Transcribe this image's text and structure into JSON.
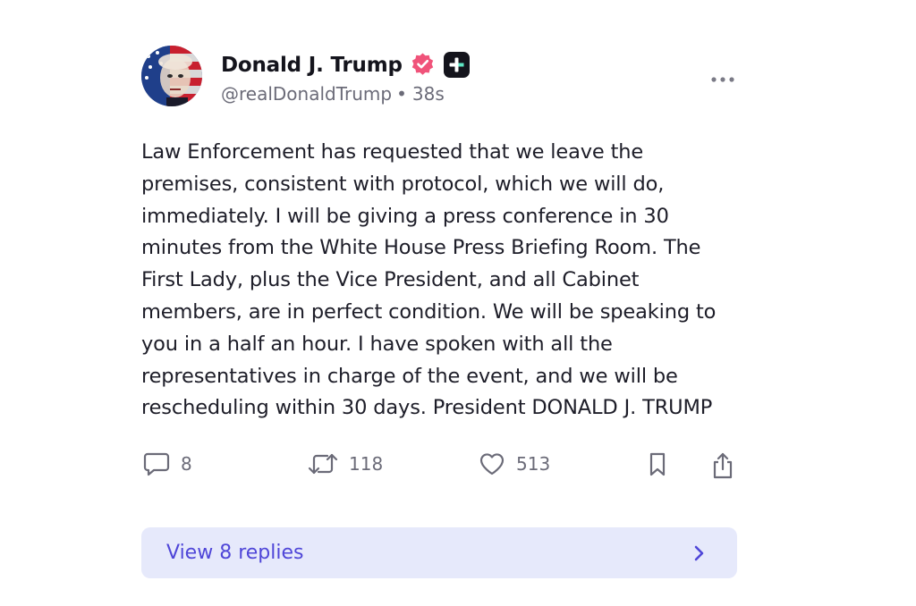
{
  "post": {
    "author": {
      "display_name": "Donald J. Trump",
      "handle": "@realDonaldTrump",
      "separator": "•",
      "time_ago": "38s"
    },
    "badges": [
      "verified-icon",
      "plus-badge-icon"
    ],
    "body": "Law Enforcement has requested that we leave the premises, consistent with protocol, which we will do, immediately. I will be giving a press conference in 30 minutes from the White House Press Briefing Room. The First Lady, plus the Vice President, and all Cabinet members, are in perfect condition. We will be speaking to you in a half an hour. I have spoken with all the representatives in charge of the event, and we will be rescheduling within 30 days. President DONALD J. TRUMP",
    "actions": {
      "replies_count": "8",
      "reposts_count": "118",
      "likes_count": "513"
    },
    "view_replies_label": "View 8 replies"
  },
  "colors": {
    "verified": "#f0537a",
    "accent": "#4f46d8",
    "replies_bg": "#e6e9fb",
    "muted_text": "#6b6b78"
  },
  "icons": {
    "more": "more-icon",
    "reply": "comment-icon",
    "repost": "repost-icon",
    "like": "heart-icon",
    "bookmark": "bookmark-icon",
    "share": "share-icon",
    "chevron": "chevron-right-icon"
  }
}
